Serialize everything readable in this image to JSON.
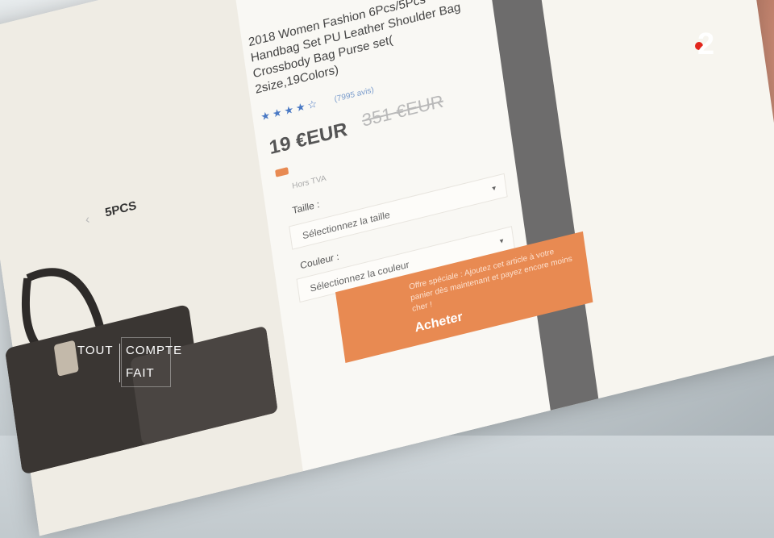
{
  "broadcast": {
    "channel_logo": "2",
    "watermark": {
      "line1a": "TOUT",
      "line1b": "COMPTE",
      "line2": "FAIT"
    }
  },
  "listing": {
    "close_glyph": "×",
    "thumb_label": "5PCS",
    "thumb_chevron": "‹",
    "title": "2018 Women Fashion 6Pcs/5Pcs Handbag Set PU Leather Shoulder Bag Crossbody Bag Purse set( 2size,19Colors)",
    "stars": "★★★★☆",
    "reviews": "(7995 avis)",
    "price": "19 €EUR",
    "old_price": "351 €EUR",
    "tax_note": "Hors TVA",
    "size_label": "Taille :",
    "size_placeholder": "Sélectionnez la taille",
    "color_label": "Couleur :",
    "color_placeholder": "Sélectionnez la couleur",
    "promo_text": "Offre spéciale : Ajoutez cet article à votre panier dès maintenant et payez encore moins cher !",
    "promo_button": "Acheter"
  },
  "colors": {
    "promo": "#e88a52",
    "stars": "#4a79c4",
    "channel_dot": "#e2261c"
  },
  "icons": {
    "close": "close-icon",
    "caret": "caret-down-icon",
    "truck": "truck-icon"
  }
}
